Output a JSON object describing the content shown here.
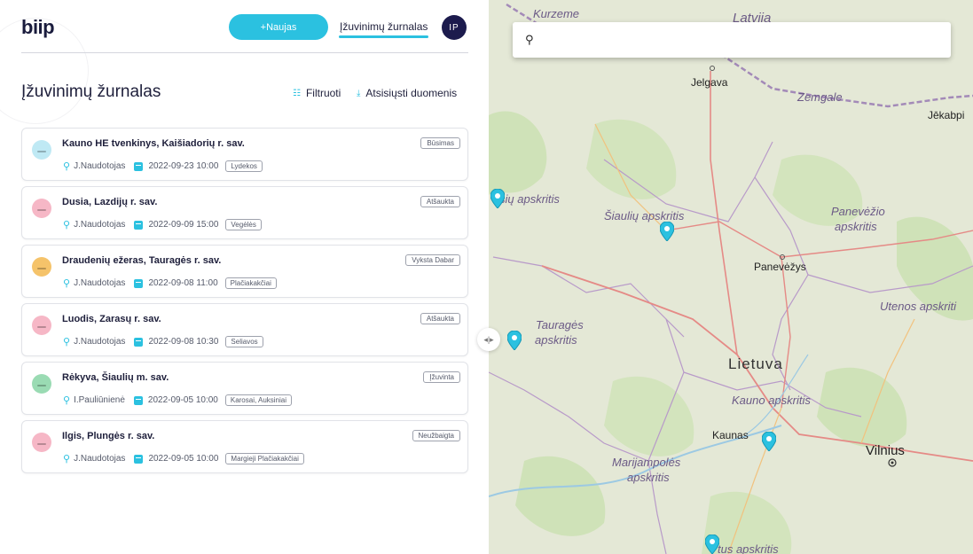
{
  "header": {
    "logo": "biip",
    "new_button": "+Naujas",
    "journal_link": "Įžuvinimų žurnalas",
    "avatar_initials": "IP"
  },
  "page": {
    "title": "Įžuvinimų žurnalas",
    "filter_label": "Filtruoti",
    "download_label": "Atsisiųsti duomenis"
  },
  "events": [
    {
      "name": "Kauno HE tvenkinys, Kaišiadorių r. sav.",
      "user": "J.Naudotojas",
      "datetime": "2022-09-23 10:00",
      "fish": "Lydekos",
      "status": "Būsimas",
      "icon_color": "#bfe9f4"
    },
    {
      "name": "Dusia, Lazdijų r. sav.",
      "user": "J.Naudotojas",
      "datetime": "2022-09-09 15:00",
      "fish": "Vegėlės",
      "status": "Atšaukta",
      "icon_color": "#f6b7c6"
    },
    {
      "name": "Draudenių ežeras, Tauragės r. sav.",
      "user": "J.Naudotojas",
      "datetime": "2022-09-08 11:00",
      "fish": "Plačiakakčiai",
      "status": "Vyksta Dabar",
      "icon_color": "#f5c36a"
    },
    {
      "name": "Luodis, Zarasų r. sav.",
      "user": "J.Naudotojas",
      "datetime": "2022-09-08 10:30",
      "fish": "Seliavos",
      "status": "Atšaukta",
      "icon_color": "#f6b7c6"
    },
    {
      "name": "Rėkyva, Šiaulių m. sav.",
      "user": "I.Pauliūnienė",
      "datetime": "2022-09-05 10:00",
      "fish": "Karosai, Auksiniai",
      "status": "Įžuvinta",
      "icon_color": "#9adbb3"
    },
    {
      "name": "Ilgis, Plungės r. sav.",
      "user": "J.Naudotojas",
      "datetime": "2022-09-05 10:00",
      "fish": "Margieji Plačiakakčiai",
      "status": "Neužbaigta",
      "icon_color": "#f6b7c6"
    }
  ],
  "map": {
    "search_value": "",
    "labels": {
      "kurzeme": "Kurzeme",
      "latvija": "Latvija",
      "jelgava": "Jelgava",
      "zemgale": "Zemgale",
      "jekabpils": "Jēkabpi",
      "siauliu": "Šiaulių apskritis",
      "siau_left": "šių apskritis",
      "panevezio_1": "Panevėžio",
      "panevezio_2": "apskritis",
      "panevezys": "Panevėžys",
      "utenos": "Utenos apskriti",
      "taurages_1": "Tauragės",
      "taurages_2": "apskritis",
      "lietuva": "Lietuva",
      "kauno": "Kauno apskritis",
      "kaunas": "Kaunas",
      "vilnius": "Vilnius",
      "marij_1": "Marijampolės",
      "marij_2": "apskritis",
      "alytaus": "tus apskritis"
    },
    "accent": "#2bc1e0"
  }
}
